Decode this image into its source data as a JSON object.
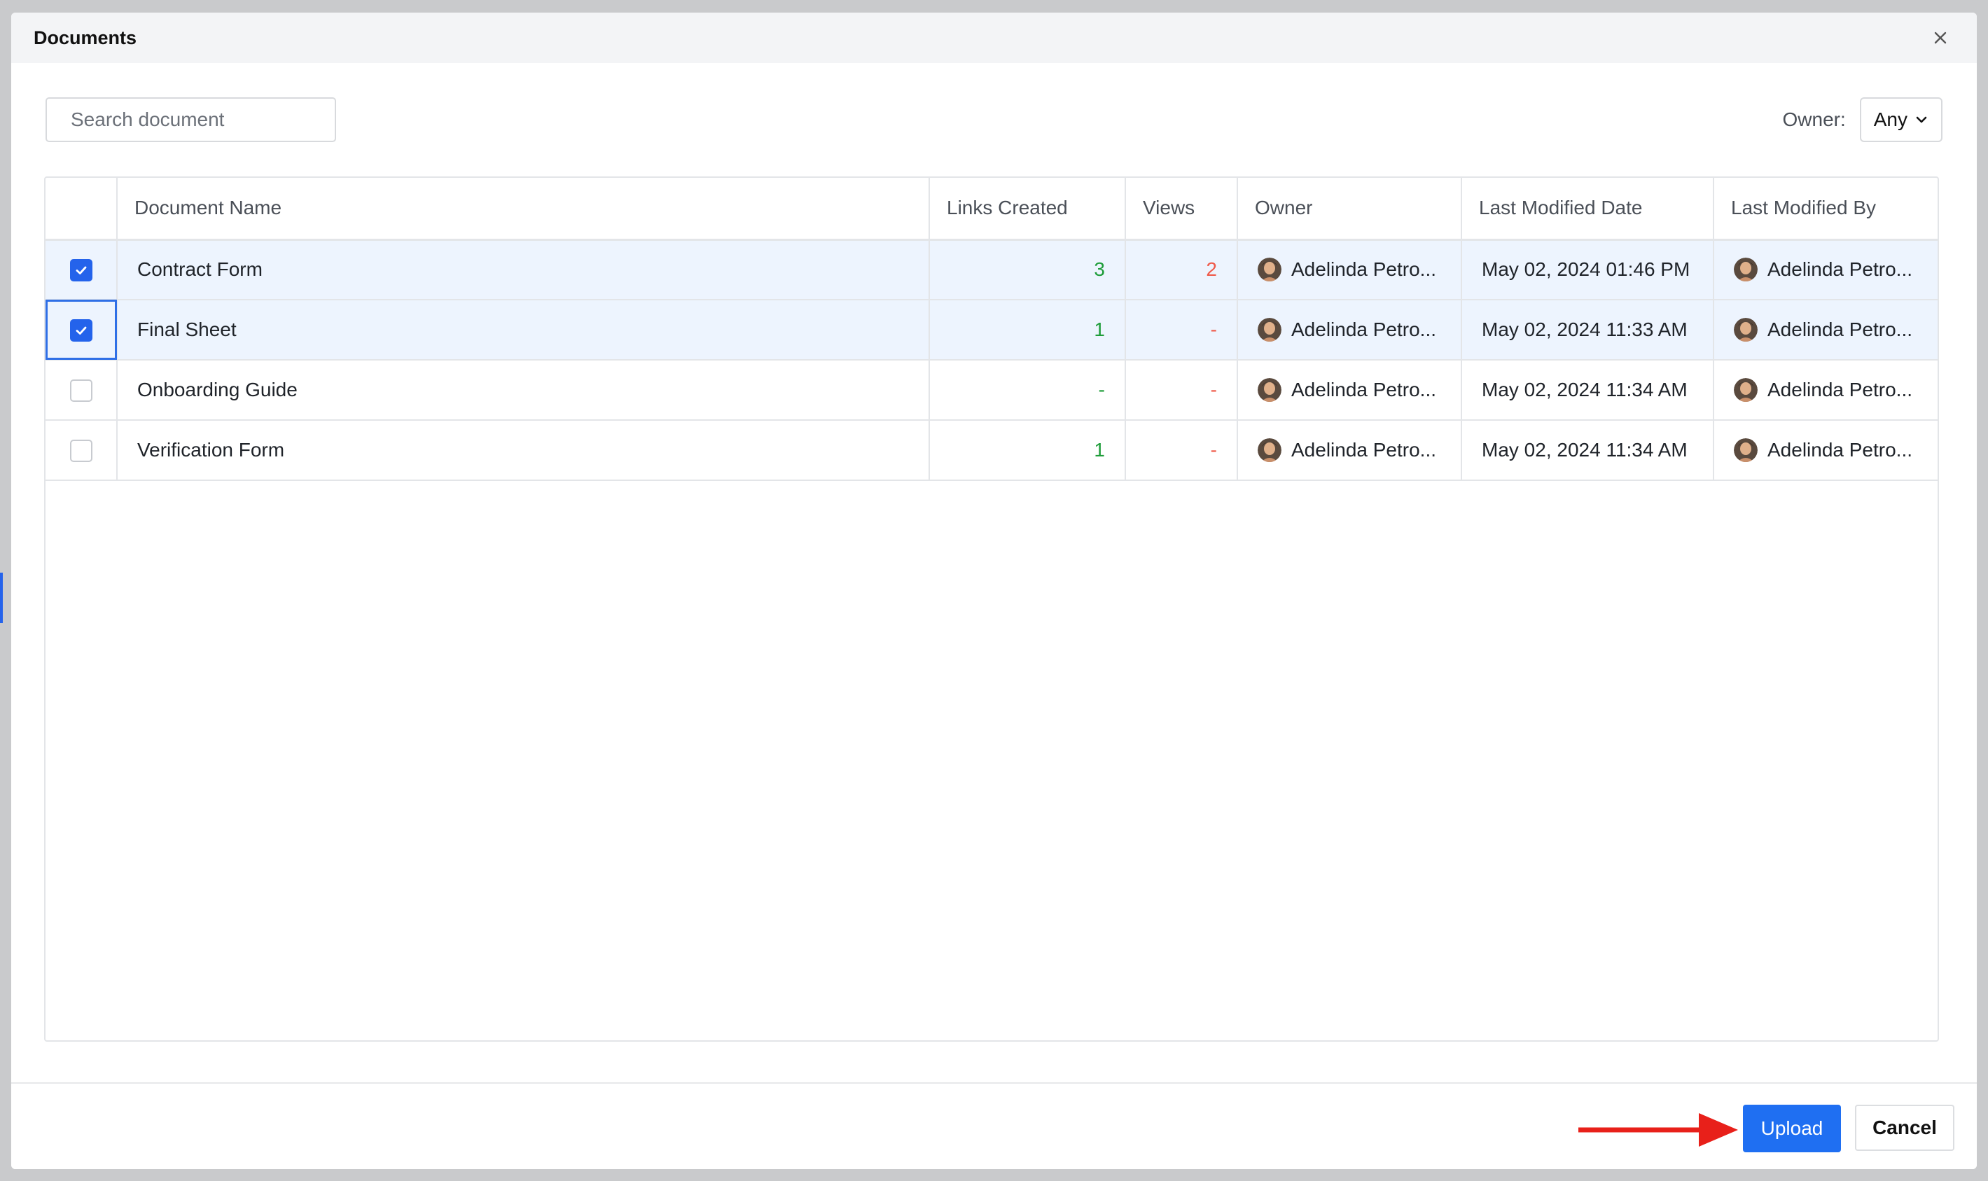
{
  "dialog": {
    "title": "Documents",
    "close_label": "×"
  },
  "search": {
    "placeholder": "Search document",
    "value": ""
  },
  "filter": {
    "label": "Owner:",
    "selected": "Any"
  },
  "table": {
    "columns": [
      "",
      "Document Name",
      "Links Created",
      "Views",
      "Owner",
      "Last Modified Date",
      "Last Modified By"
    ],
    "rows": [
      {
        "checked": true,
        "name": "Contract Form",
        "links": "3",
        "views": "2",
        "owner": "Adelinda Petro...",
        "modified": "May 02, 2024 01:46 PM",
        "modified_by": "Adelinda Petro..."
      },
      {
        "checked": true,
        "name": "Final Sheet",
        "links": "1",
        "views": "-",
        "owner": "Adelinda Petro...",
        "modified": "May 02, 2024 11:33 AM",
        "modified_by": "Adelinda Petro..."
      },
      {
        "checked": false,
        "name": "Onboarding Guide",
        "links": "-",
        "views": "-",
        "owner": "Adelinda Petro...",
        "modified": "May 02, 2024 11:34 AM",
        "modified_by": "Adelinda Petro..."
      },
      {
        "checked": false,
        "name": "Verification Form",
        "links": "1",
        "views": "-",
        "owner": "Adelinda Petro...",
        "modified": "May 02, 2024 11:34 AM",
        "modified_by": "Adelinda Petro..."
      }
    ]
  },
  "footer": {
    "upload_label": "Upload",
    "cancel_label": "Cancel"
  },
  "colors": {
    "accent": "#1f6ff2",
    "links_positive": "#1f9d3a",
    "views_positive": "#ef5a4a",
    "annotation_arrow": "#e8201a"
  },
  "icons": {
    "search": "search-icon",
    "dropdown": "chevron-down-icon",
    "close": "close-icon",
    "check": "check-icon",
    "avatar": "avatar"
  }
}
